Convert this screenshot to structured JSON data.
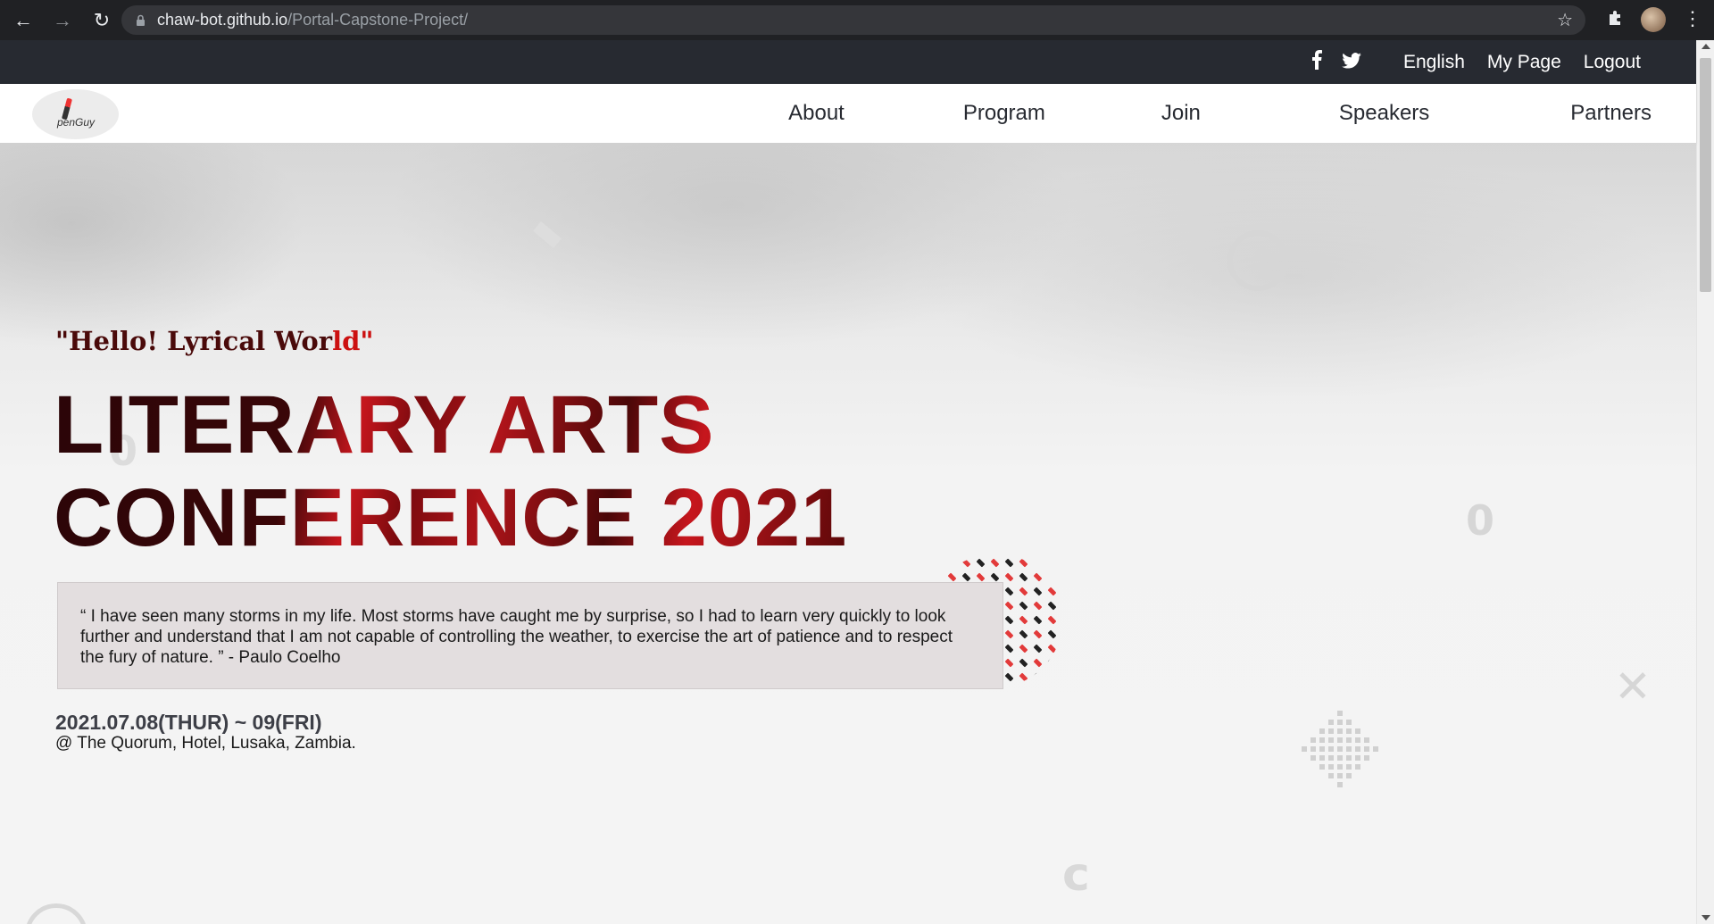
{
  "browser": {
    "url_host": "chaw-bot.github.io",
    "url_path": "/Portal-Capstone-Project/"
  },
  "topbar": {
    "social": [
      "facebook-icon",
      "twitter-icon"
    ],
    "links": [
      "English",
      "My Page",
      "Logout"
    ]
  },
  "logo": {
    "text": "penGuy"
  },
  "nav": {
    "items": [
      "About",
      "Program",
      "Join",
      "Speakers",
      "Partners"
    ]
  },
  "hero": {
    "subtitle_main": "\"Hello! Lyrical Wor",
    "subtitle_red": "ld\"",
    "title_line1": "LITERARY ARTS",
    "title_line2": "CONFERENCE 2021",
    "quote": "“ I have seen many storms in my life. Most storms have caught me by surprise, so I had to learn very quickly to look further and understand that I am not capable of controlling the weather, to exercise the art of patience and to respect the fury of nature. ” - Paulo Coelho",
    "date": "2021.07.08(THUR) ~ 09(FRI)",
    "venue": "@ The Quorum, Hotel, Lusaka, Zambia."
  },
  "colors": {
    "topbar_bg": "#272a31",
    "accent_red": "#c6161d",
    "dark_red": "#2b0508",
    "quote_bg": "#e3dedf"
  }
}
